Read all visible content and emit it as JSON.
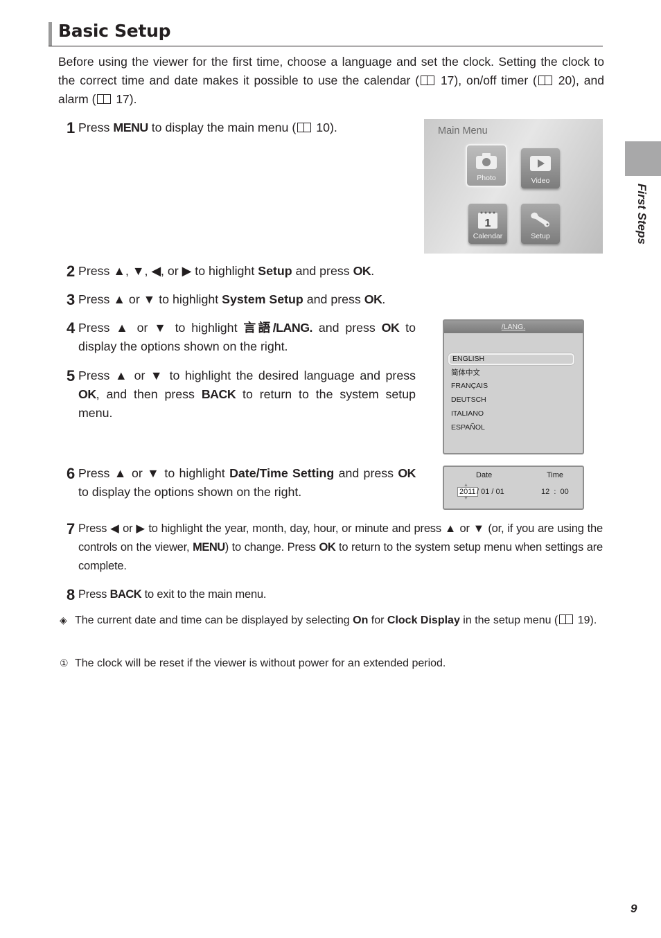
{
  "page": {
    "title": "Basic Setup",
    "section_tab": "First Steps",
    "page_number": "9"
  },
  "intro": {
    "part1": "Before using the viewer for the first time, choose a language and set the clock.  Setting the clock to the correct time and date makes it possible to use the calendar (",
    "ref1": "17), on/off timer (",
    "ref2": "20), and alarm (",
    "ref3": "17)."
  },
  "steps": [
    {
      "num": "1",
      "a": "Press ",
      "k1": "MENU",
      "b": " to display the main menu (",
      "c": "10)."
    },
    {
      "num": "2",
      "a": "Press ▲, ▼, ◀, or ▶ to highlight ",
      "bold": "Setup",
      "b": " and press ",
      "k1": "OK",
      "c": "."
    },
    {
      "num": "3",
      "a": "Press ▲ or ▼ to highlight ",
      "bold": "System Setup",
      "b": " and press ",
      "k1": "OK",
      "c": "."
    },
    {
      "num": "4",
      "a": "Press ▲ or ▼ to highlight ",
      "bold": "言語/LANG.",
      "b": " and press ",
      "k1": "OK",
      "c": " to display the options shown on the right."
    },
    {
      "num": "5",
      "a": "Press ▲ or ▼ to highlight the desired language and press ",
      "k1": "OK",
      "b": ", and then press ",
      "k2": "BACK",
      "c": " to return to the system setup menu."
    },
    {
      "num": "6",
      "a": "Press ▲ or ▼ to highlight ",
      "bold": "Date/Time Setting",
      "b": " and press ",
      "k1": "OK",
      "c": " to display the options shown on the right."
    },
    {
      "num": "7",
      "a": "Press ◀ or ▶ to highlight the year, month, day, hour, or minute and press ▲ or ▼ (or, if you are using the controls on the viewer, ",
      "k1": "MENU",
      "b": ") to change.  Press ",
      "k2": "OK",
      "c": " to return to the system setup menu when settings are complete."
    },
    {
      "num": "8",
      "a": "Press ",
      "k1": "BACK",
      "b": " to exit to the main menu."
    }
  ],
  "notes": [
    {
      "icon": "tip-icon",
      "glyph": "◈",
      "a": "The current date and time can be displayed by selecting ",
      "b1": "On",
      "b": " for ",
      "b2": "Clock Display",
      "c": " in the setup menu (",
      "d": "19)."
    },
    {
      "icon": "caution-icon",
      "glyph": "⓵",
      "a": "The clock will be reset if the viewer is without power for an extended period."
    }
  ],
  "main_menu_screen": {
    "title": "Main Menu",
    "tiles": [
      {
        "label": "Photo",
        "icon": "camera-icon",
        "selected": true
      },
      {
        "label": "Video",
        "icon": "play-icon",
        "selected": false
      },
      {
        "label": "Calendar",
        "icon": "calendar-icon",
        "selected": false
      },
      {
        "label": "Setup",
        "icon": "wrench-icon",
        "selected": false
      }
    ]
  },
  "lang_screen": {
    "header": "/LANG.",
    "options": [
      "ENGLISH",
      "简体中文",
      "FRANÇAIS",
      "DEUTSCH",
      "ITALIANO",
      "ESPAÑOL"
    ],
    "selected": "ENGLISH"
  },
  "datetime_screen": {
    "date_label": "Date",
    "time_label": "Time",
    "year": "2011",
    "month_day": " / 01 / 01",
    "time": "12  :  00"
  }
}
